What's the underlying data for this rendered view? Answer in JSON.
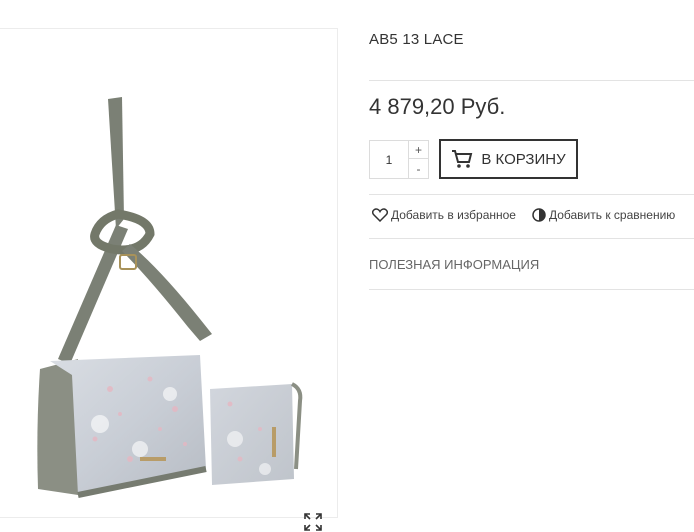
{
  "product": {
    "title": "AB5 13 LACE",
    "price": "4 879,20 Руб.",
    "image_alt": "Сумка AB5 13 LACE"
  },
  "quantity": {
    "value": "1",
    "plus_label": "+",
    "minus_label": "-"
  },
  "cart": {
    "button_label": "В КОРЗИНУ",
    "icon": "cart-icon"
  },
  "actions": {
    "favorite_label": "Добавить в избранное",
    "favorite_icon": "heart-icon",
    "compare_label": "Добавить к сравнению",
    "compare_icon": "half-circle-icon"
  },
  "info_tab": {
    "label": "ПОЛЕЗНАЯ ИНФОРМАЦИЯ"
  },
  "gallery": {
    "expand_icon": "expand-icon"
  }
}
